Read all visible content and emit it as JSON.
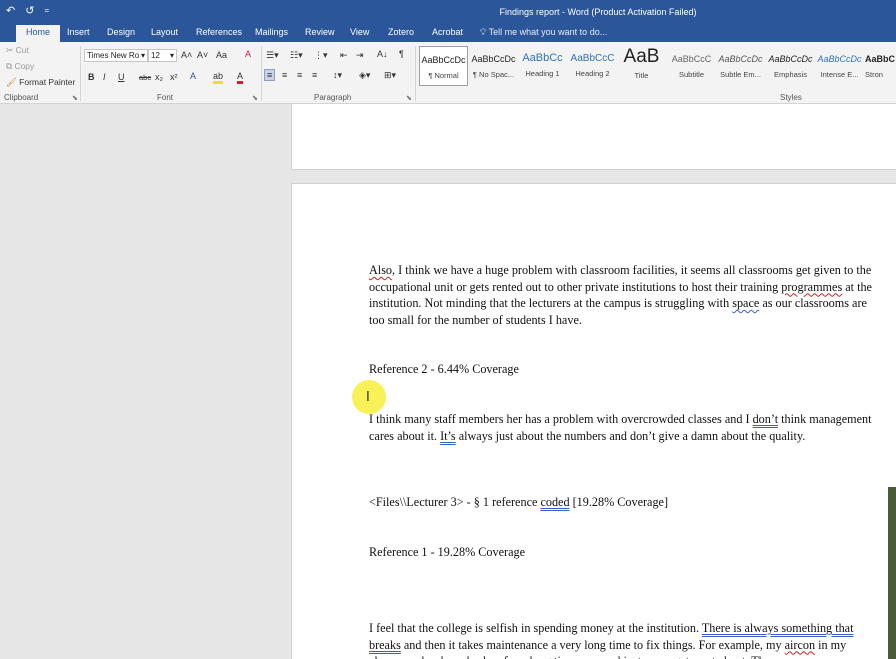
{
  "window": {
    "title": "Findings report - Word (Product Activation Failed)",
    "qat": {
      "undo": "↶",
      "redo": "↺",
      "more": "="
    }
  },
  "tabs": [
    "Home",
    "Insert",
    "Design",
    "Layout",
    "References",
    "Mailings",
    "Review",
    "View",
    "Zotero",
    "Acrobat"
  ],
  "tell_me": "Tell me what you want to do...",
  "clipboard": {
    "label": "Clipboard",
    "cut": "Cut",
    "copy": "Copy",
    "format_painter": "Format Painter"
  },
  "font": {
    "label": "Font",
    "name": "Times New Ro",
    "size": "12",
    "grow": "A˄",
    "shrink": "A˅",
    "case": "Aa",
    "clear": "A",
    "bold": "B",
    "italic": "I",
    "underline": "U",
    "strike": "abc",
    "sub": "x₂",
    "sup": "x²",
    "effects": "A",
    "highlight": "ab",
    "color": "A"
  },
  "paragraph": {
    "label": "Paragraph",
    "pilcrow": "¶",
    "sort": "A↓"
  },
  "styles": {
    "label": "Styles",
    "items": [
      {
        "preview": "AaBbCcDc",
        "name": "¶ Normal"
      },
      {
        "preview": "AaBbCcDc",
        "name": "¶ No Spac..."
      },
      {
        "preview": "AaBbCc",
        "name": "Heading 1"
      },
      {
        "preview": "AaBbCcC",
        "name": "Heading 2"
      },
      {
        "preview": "AaB",
        "name": "Title"
      },
      {
        "preview": "AaBbCcC",
        "name": "Subtitle"
      },
      {
        "preview": "AaBbCcDc",
        "name": "Subtle Em..."
      },
      {
        "preview": "AaBbCcDc",
        "name": "Emphasis"
      },
      {
        "preview": "AaBbCcDc",
        "name": "Intense E..."
      },
      {
        "preview": "AaBbC",
        "name": "Stron"
      }
    ]
  },
  "document": {
    "p1": {
      "a": "Also",
      "b": ", I think we have a huge problem with classroom facilities, it seems all classrooms get given to the occupational unit or gets rented out to other private institutions to host their training ",
      "c": "programmes",
      "d": " at the institution. Not minding that the lecturers at the campus is struggling with ",
      "e": "space",
      "f": " as our classrooms are too small for the number of students I have."
    },
    "ref2": "Reference 2 - 6.44% Coverage",
    "p2": {
      "a": "I think many staff members her has a problem with overcrowded classes and I ",
      "b": "don’t",
      "c": " think management cares about it. ",
      "d": "It’s",
      "e": " always just about the numbers and don’t give a damn about the quality."
    },
    "files_line": {
      "a": "<Files\\\\Lecturer 3> - § 1 reference ",
      "b": "coded",
      "c": "  [19.28% Coverage]"
    },
    "ref1": "Reference 1 - 19.28% Coverage",
    "p3": {
      "a": "I feel that the college is selfish in spending money at the institution. ",
      "b": "There is always something that breaks",
      "c": " and then it takes maintenance a very long time to fix things. For example, my ",
      "d": "aircon",
      "e": " in my classroom has been broken for a long time now and just never gets sorted out. The"
    }
  }
}
